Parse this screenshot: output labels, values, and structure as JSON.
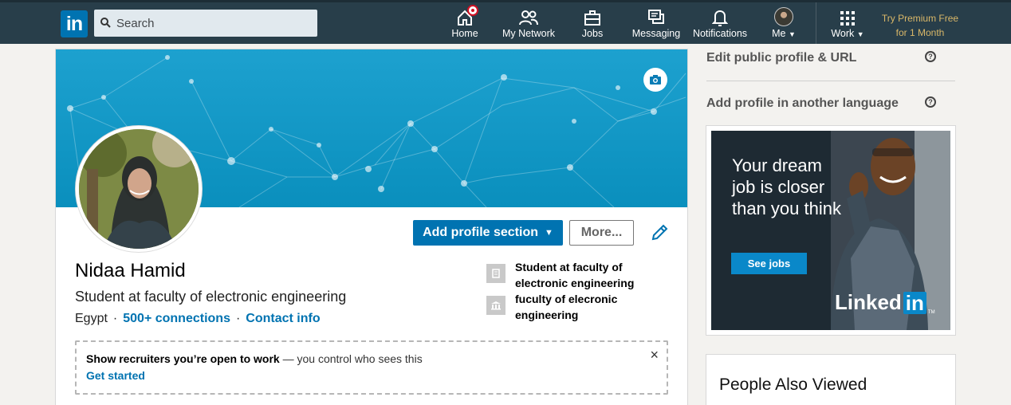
{
  "nav": {
    "logo": "in",
    "search_placeholder": "Search",
    "items": [
      {
        "label": "Home",
        "icon": "home-icon"
      },
      {
        "label": "My Network",
        "icon": "network-icon"
      },
      {
        "label": "Jobs",
        "icon": "briefcase-icon"
      },
      {
        "label": "Messaging",
        "icon": "messaging-icon"
      },
      {
        "label": "Notifications",
        "icon": "bell-icon"
      },
      {
        "label": "Me",
        "icon": "avatar"
      },
      {
        "label": "Work",
        "icon": "grid-icon"
      }
    ],
    "premium_line1": "Try Premium Free",
    "premium_line2": "for 1 Month"
  },
  "profile": {
    "name": "Nidaa Hamid",
    "headline": "Student at faculty of electronic engineering",
    "location": "Egypt",
    "separator": "·",
    "connections": "500+ connections",
    "contact": "Contact info",
    "add_section_label": "Add profile section",
    "more_label": "More...",
    "education": [
      {
        "text": "Student at faculty of electronic engineering",
        "icon": "building-icon"
      },
      {
        "text": "fuculty of elecronic engineering",
        "icon": "school-icon"
      }
    ]
  },
  "open_to_work": {
    "bold": "Show recruiters you’re open to work",
    "rest": " — you control who sees this",
    "cta": "Get started",
    "close": "×"
  },
  "rail": {
    "edit_public": "Edit public profile & URL",
    "add_language": "Add profile in another language",
    "help": "?",
    "ad_copy": "Your dream job is closer than you think",
    "ad_button": "See jobs",
    "ad_brand": "Linked",
    "ad_brand_in": "in",
    "ad_tm": "TM",
    "people_also_viewed": "People Also Viewed"
  },
  "colors": {
    "nav_bg": "#283e4a",
    "brand_blue": "#0073b1",
    "premium_gold": "#d9b768",
    "banner": "#1da1cf"
  }
}
